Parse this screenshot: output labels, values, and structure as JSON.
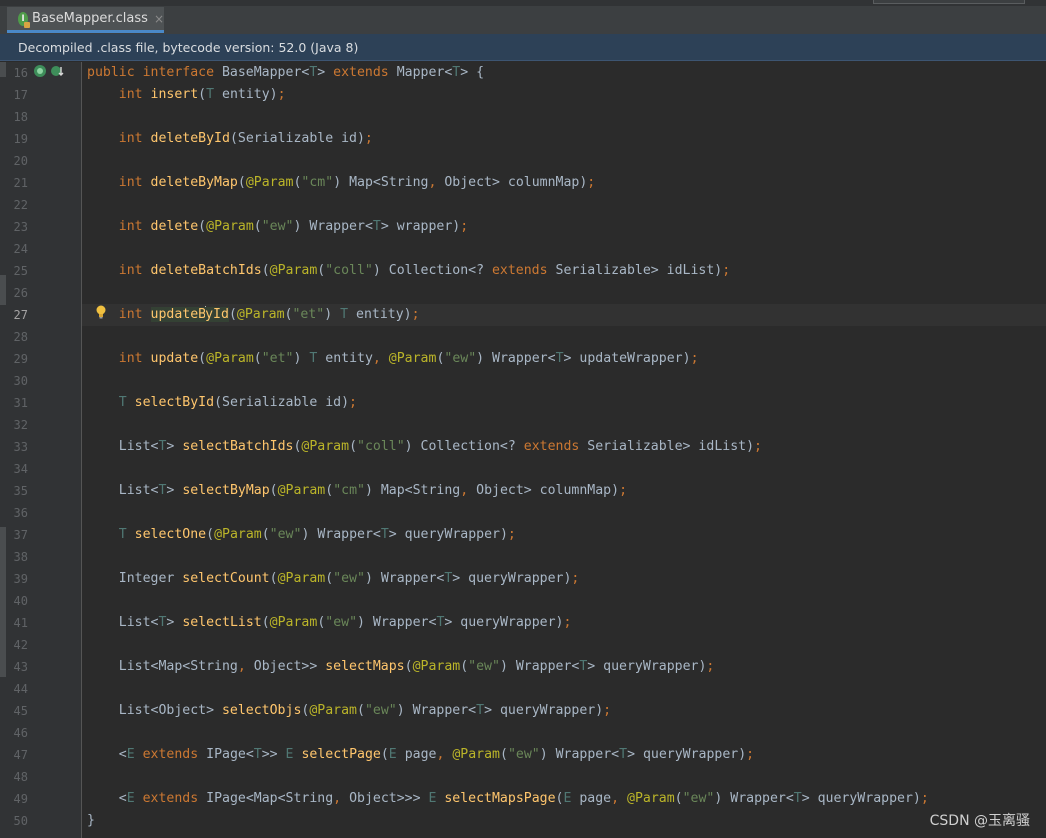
{
  "tab": {
    "title": "BaseMapper.class",
    "close": "×",
    "icon_letter": "I"
  },
  "banner": {
    "text": "Decompiled .class file, bytecode version: 52.0 (Java 8)"
  },
  "current_line": 27,
  "lines": [
    {
      "n": "16",
      "tokens": [
        [
          "kw",
          "public "
        ],
        [
          "kw",
          "interface "
        ],
        [
          "pl",
          "BaseMapper<"
        ],
        [
          "tp",
          "T"
        ],
        [
          "pl",
          "> "
        ],
        [
          "kw",
          "extends "
        ],
        [
          "pl",
          "Mapper<"
        ],
        [
          "tp",
          "T"
        ],
        [
          "pl",
          "> {"
        ]
      ]
    },
    {
      "n": "17",
      "tokens": [
        [
          "pl",
          "    "
        ],
        [
          "kw",
          "int "
        ],
        [
          "fn",
          "insert"
        ],
        [
          "pl",
          "("
        ],
        [
          "tp",
          "T"
        ],
        [
          "pl",
          " entity)"
        ],
        [
          "cm",
          ";"
        ]
      ]
    },
    {
      "n": "18",
      "tokens": []
    },
    {
      "n": "19",
      "tokens": [
        [
          "pl",
          "    "
        ],
        [
          "kw",
          "int "
        ],
        [
          "fn",
          "deleteById"
        ],
        [
          "pl",
          "(Serializable id)"
        ],
        [
          "cm",
          ";"
        ]
      ]
    },
    {
      "n": "20",
      "tokens": []
    },
    {
      "n": "21",
      "tokens": [
        [
          "pl",
          "    "
        ],
        [
          "kw",
          "int "
        ],
        [
          "fn",
          "deleteByMap"
        ],
        [
          "pl",
          "("
        ],
        [
          "an",
          "@Param"
        ],
        [
          "pl",
          "("
        ],
        [
          "st",
          "\"cm\""
        ],
        [
          "pl",
          ") Map<String"
        ],
        [
          "cm",
          ", "
        ],
        [
          "pl",
          "Object> columnMap)"
        ],
        [
          "cm",
          ";"
        ]
      ]
    },
    {
      "n": "22",
      "tokens": []
    },
    {
      "n": "23",
      "tokens": [
        [
          "pl",
          "    "
        ],
        [
          "kw",
          "int "
        ],
        [
          "fn",
          "delete"
        ],
        [
          "pl",
          "("
        ],
        [
          "an",
          "@Param"
        ],
        [
          "pl",
          "("
        ],
        [
          "st",
          "\"ew\""
        ],
        [
          "pl",
          ") Wrapper<"
        ],
        [
          "tp",
          "T"
        ],
        [
          "pl",
          "> wrapper)"
        ],
        [
          "cm",
          ";"
        ]
      ]
    },
    {
      "n": "24",
      "tokens": []
    },
    {
      "n": "25",
      "tokens": [
        [
          "pl",
          "    "
        ],
        [
          "kw",
          "int "
        ],
        [
          "fn",
          "deleteBatchIds"
        ],
        [
          "pl",
          "("
        ],
        [
          "an",
          "@Param"
        ],
        [
          "pl",
          "("
        ],
        [
          "st",
          "\"coll\""
        ],
        [
          "pl",
          ") Collection<? "
        ],
        [
          "kw",
          "extends "
        ],
        [
          "pl",
          "Serializable> idList)"
        ],
        [
          "cm",
          ";"
        ]
      ]
    },
    {
      "n": "26",
      "tokens": []
    },
    {
      "n": "27",
      "tokens": [
        [
          "pl",
          "    "
        ],
        [
          "kw",
          "int "
        ],
        [
          "fnhl",
          "updateB"
        ],
        [
          "caret",
          ""
        ],
        [
          "fnhl",
          "yId"
        ],
        [
          "pl",
          "("
        ],
        [
          "an",
          "@Param"
        ],
        [
          "pl",
          "("
        ],
        [
          "st",
          "\"et\""
        ],
        [
          "pl",
          ") "
        ],
        [
          "tp",
          "T"
        ],
        [
          "pl",
          " entity)"
        ],
        [
          "cm",
          ";"
        ]
      ]
    },
    {
      "n": "28",
      "tokens": []
    },
    {
      "n": "29",
      "tokens": [
        [
          "pl",
          "    "
        ],
        [
          "kw",
          "int "
        ],
        [
          "fn",
          "update"
        ],
        [
          "pl",
          "("
        ],
        [
          "an",
          "@Param"
        ],
        [
          "pl",
          "("
        ],
        [
          "st",
          "\"et\""
        ],
        [
          "pl",
          ") "
        ],
        [
          "tp",
          "T"
        ],
        [
          "pl",
          " entity"
        ],
        [
          "cm",
          ", "
        ],
        [
          "an",
          "@Param"
        ],
        [
          "pl",
          "("
        ],
        [
          "st",
          "\"ew\""
        ],
        [
          "pl",
          ") Wrapper<"
        ],
        [
          "tp",
          "T"
        ],
        [
          "pl",
          "> updateWrapper)"
        ],
        [
          "cm",
          ";"
        ]
      ]
    },
    {
      "n": "30",
      "tokens": []
    },
    {
      "n": "31",
      "tokens": [
        [
          "pl",
          "    "
        ],
        [
          "tp",
          "T "
        ],
        [
          "fn",
          "selectById"
        ],
        [
          "pl",
          "(Serializable id)"
        ],
        [
          "cm",
          ";"
        ]
      ]
    },
    {
      "n": "32",
      "tokens": []
    },
    {
      "n": "33",
      "tokens": [
        [
          "pl",
          "    List<"
        ],
        [
          "tp",
          "T"
        ],
        [
          "pl",
          "> "
        ],
        [
          "fn",
          "selectBatchIds"
        ],
        [
          "pl",
          "("
        ],
        [
          "an",
          "@Param"
        ],
        [
          "pl",
          "("
        ],
        [
          "st",
          "\"coll\""
        ],
        [
          "pl",
          ") Collection<? "
        ],
        [
          "kw",
          "extends "
        ],
        [
          "pl",
          "Serializable> idList)"
        ],
        [
          "cm",
          ";"
        ]
      ]
    },
    {
      "n": "34",
      "tokens": []
    },
    {
      "n": "35",
      "tokens": [
        [
          "pl",
          "    List<"
        ],
        [
          "tp",
          "T"
        ],
        [
          "pl",
          "> "
        ],
        [
          "fn",
          "selectByMap"
        ],
        [
          "pl",
          "("
        ],
        [
          "an",
          "@Param"
        ],
        [
          "pl",
          "("
        ],
        [
          "st",
          "\"cm\""
        ],
        [
          "pl",
          ") Map<String"
        ],
        [
          "cm",
          ", "
        ],
        [
          "pl",
          "Object> columnMap)"
        ],
        [
          "cm",
          ";"
        ]
      ]
    },
    {
      "n": "36",
      "tokens": []
    },
    {
      "n": "37",
      "tokens": [
        [
          "pl",
          "    "
        ],
        [
          "tp",
          "T "
        ],
        [
          "fn",
          "selectOne"
        ],
        [
          "pl",
          "("
        ],
        [
          "an",
          "@Param"
        ],
        [
          "pl",
          "("
        ],
        [
          "st",
          "\"ew\""
        ],
        [
          "pl",
          ") Wrapper<"
        ],
        [
          "tp",
          "T"
        ],
        [
          "pl",
          "> queryWrapper)"
        ],
        [
          "cm",
          ";"
        ]
      ]
    },
    {
      "n": "38",
      "tokens": []
    },
    {
      "n": "39",
      "tokens": [
        [
          "pl",
          "    Integer "
        ],
        [
          "fn",
          "selectCount"
        ],
        [
          "pl",
          "("
        ],
        [
          "an",
          "@Param"
        ],
        [
          "pl",
          "("
        ],
        [
          "st",
          "\"ew\""
        ],
        [
          "pl",
          ") Wrapper<"
        ],
        [
          "tp",
          "T"
        ],
        [
          "pl",
          "> queryWrapper)"
        ],
        [
          "cm",
          ";"
        ]
      ]
    },
    {
      "n": "40",
      "tokens": []
    },
    {
      "n": "41",
      "tokens": [
        [
          "pl",
          "    List<"
        ],
        [
          "tp",
          "T"
        ],
        [
          "pl",
          "> "
        ],
        [
          "fn",
          "selectList"
        ],
        [
          "pl",
          "("
        ],
        [
          "an",
          "@Param"
        ],
        [
          "pl",
          "("
        ],
        [
          "st",
          "\"ew\""
        ],
        [
          "pl",
          ") Wrapper<"
        ],
        [
          "tp",
          "T"
        ],
        [
          "pl",
          "> queryWrapper)"
        ],
        [
          "cm",
          ";"
        ]
      ]
    },
    {
      "n": "42",
      "tokens": []
    },
    {
      "n": "43",
      "tokens": [
        [
          "pl",
          "    List<Map<String"
        ],
        [
          "cm",
          ", "
        ],
        [
          "pl",
          "Object>> "
        ],
        [
          "fn",
          "selectMaps"
        ],
        [
          "pl",
          "("
        ],
        [
          "an",
          "@Param"
        ],
        [
          "pl",
          "("
        ],
        [
          "st",
          "\"ew\""
        ],
        [
          "pl",
          ") Wrapper<"
        ],
        [
          "tp",
          "T"
        ],
        [
          "pl",
          "> queryWrapper)"
        ],
        [
          "cm",
          ";"
        ]
      ]
    },
    {
      "n": "44",
      "tokens": []
    },
    {
      "n": "45",
      "tokens": [
        [
          "pl",
          "    List<Object> "
        ],
        [
          "fn",
          "selectObjs"
        ],
        [
          "pl",
          "("
        ],
        [
          "an",
          "@Param"
        ],
        [
          "pl",
          "("
        ],
        [
          "st",
          "\"ew\""
        ],
        [
          "pl",
          ") Wrapper<"
        ],
        [
          "tp",
          "T"
        ],
        [
          "pl",
          "> queryWrapper)"
        ],
        [
          "cm",
          ";"
        ]
      ]
    },
    {
      "n": "46",
      "tokens": []
    },
    {
      "n": "47",
      "tokens": [
        [
          "pl",
          "    <"
        ],
        [
          "tp",
          "E "
        ],
        [
          "kw",
          "extends "
        ],
        [
          "pl",
          "IPage<"
        ],
        [
          "tp",
          "T"
        ],
        [
          "pl",
          ">> "
        ],
        [
          "tp",
          "E "
        ],
        [
          "fn",
          "selectPage"
        ],
        [
          "pl",
          "("
        ],
        [
          "tp",
          "E"
        ],
        [
          "pl",
          " page"
        ],
        [
          "cm",
          ", "
        ],
        [
          "an",
          "@Param"
        ],
        [
          "pl",
          "("
        ],
        [
          "st",
          "\"ew\""
        ],
        [
          "pl",
          ") Wrapper<"
        ],
        [
          "tp",
          "T"
        ],
        [
          "pl",
          "> queryWrapper)"
        ],
        [
          "cm",
          ";"
        ]
      ]
    },
    {
      "n": "48",
      "tokens": []
    },
    {
      "n": "49",
      "tokens": [
        [
          "pl",
          "    <"
        ],
        [
          "tp",
          "E "
        ],
        [
          "kw",
          "extends "
        ],
        [
          "pl",
          "IPage<Map<String"
        ],
        [
          "cm",
          ", "
        ],
        [
          "pl",
          "Object>>> "
        ],
        [
          "tp",
          "E "
        ],
        [
          "fn",
          "selectMapsPage"
        ],
        [
          "pl",
          "("
        ],
        [
          "tp",
          "E"
        ],
        [
          "pl",
          " page"
        ],
        [
          "cm",
          ", "
        ],
        [
          "an",
          "@Param"
        ],
        [
          "pl",
          "("
        ],
        [
          "st",
          "\"ew\""
        ],
        [
          "pl",
          ") Wrapper<"
        ],
        [
          "tp",
          "T"
        ],
        [
          "pl",
          "> queryWrapper)"
        ],
        [
          "cm",
          ";"
        ]
      ]
    },
    {
      "n": "50",
      "tokens": [
        [
          "pl",
          "}"
        ]
      ]
    }
  ],
  "watermark": "CSDN @玉离骚",
  "icons": {
    "tab": "interface-file-icon",
    "gutter": [
      "implemented-icon",
      "overrides-icon"
    ],
    "bulb": "lightbulb-icon"
  },
  "colors": {
    "keyword": "#cc7832",
    "method": "#ffc66d",
    "annotation": "#bbb529",
    "string": "#6a8759",
    "type_param": "#507874",
    "plain": "#a9b7c6"
  }
}
